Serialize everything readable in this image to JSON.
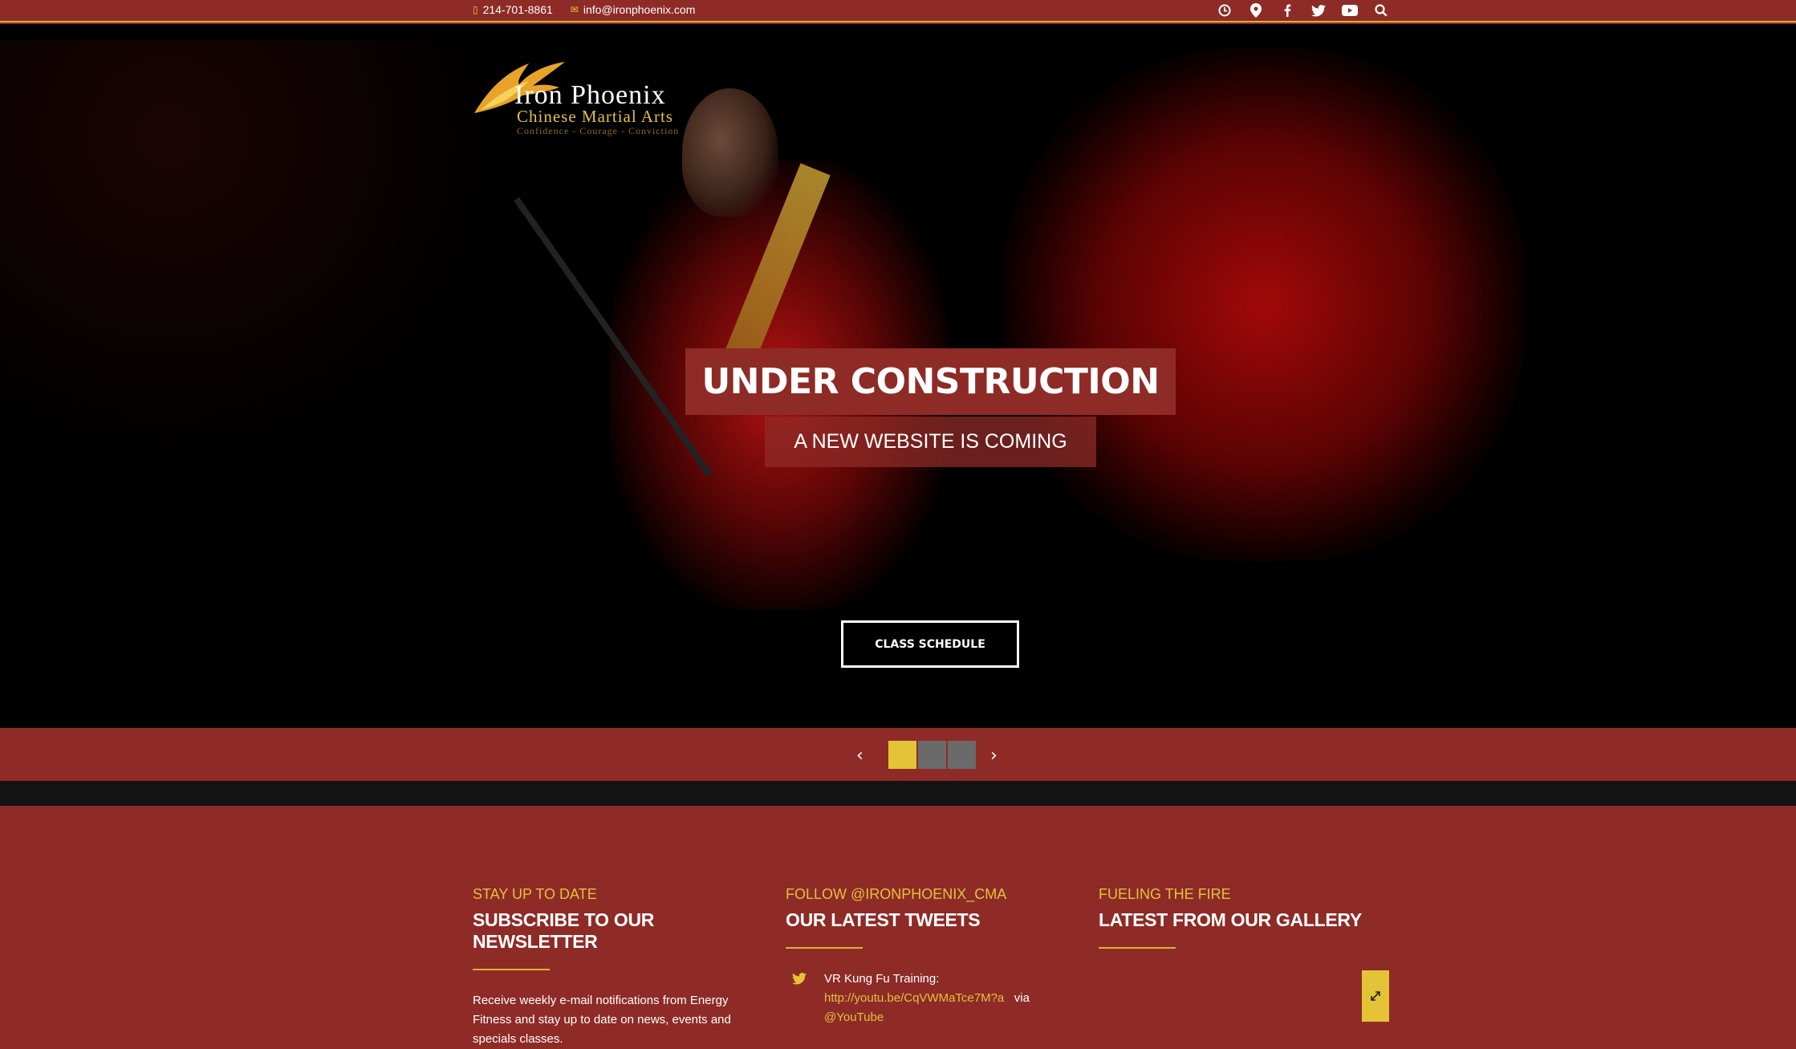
{
  "topbar": {
    "phone": "214-701-8861",
    "email": "info@ironphoenix.com",
    "icons": [
      "clock-icon",
      "map-pin-icon",
      "facebook-icon",
      "twitter-icon",
      "youtube-icon",
      "search-icon"
    ]
  },
  "logo": {
    "line1": "Iron Phoenix",
    "line2": "Chinese Martial Arts",
    "tagline": "Confidence - Courage - Conviction"
  },
  "hero": {
    "headline": "UNDER CONSTRUCTION",
    "subheadline": "A NEW WEBSITE IS COMING",
    "cta": "CLASS SCHEDULE"
  },
  "slider": {
    "prev": "‹",
    "next": "›",
    "active_index": 0,
    "count": 3
  },
  "columns": {
    "newsletter": {
      "kicker": "STAY UP TO DATE",
      "title": "SUBSCRIBE TO OUR NEWSLETTER",
      "body": "Receive weekly e-mail notifications from Energy Fitness and stay up to date on news, events and specials classes."
    },
    "tweets": {
      "kicker": "FOLLOW @IRONPHOENIX_CMA",
      "title": "OUR LATEST TWEETS",
      "tweet_text": "VR Kung Fu Training:",
      "tweet_link": "http://youtu.be/CqVWMaTce7M?a",
      "tweet_via": "via",
      "tweet_handle": "@YouTube"
    },
    "gallery": {
      "kicker": "FUELING THE FIRE",
      "title": "LATEST FROM OUR GALLERY"
    }
  },
  "colors": {
    "brand_red": "#8e2b27",
    "accent_gold": "#e5c336",
    "dark": "#131313"
  }
}
